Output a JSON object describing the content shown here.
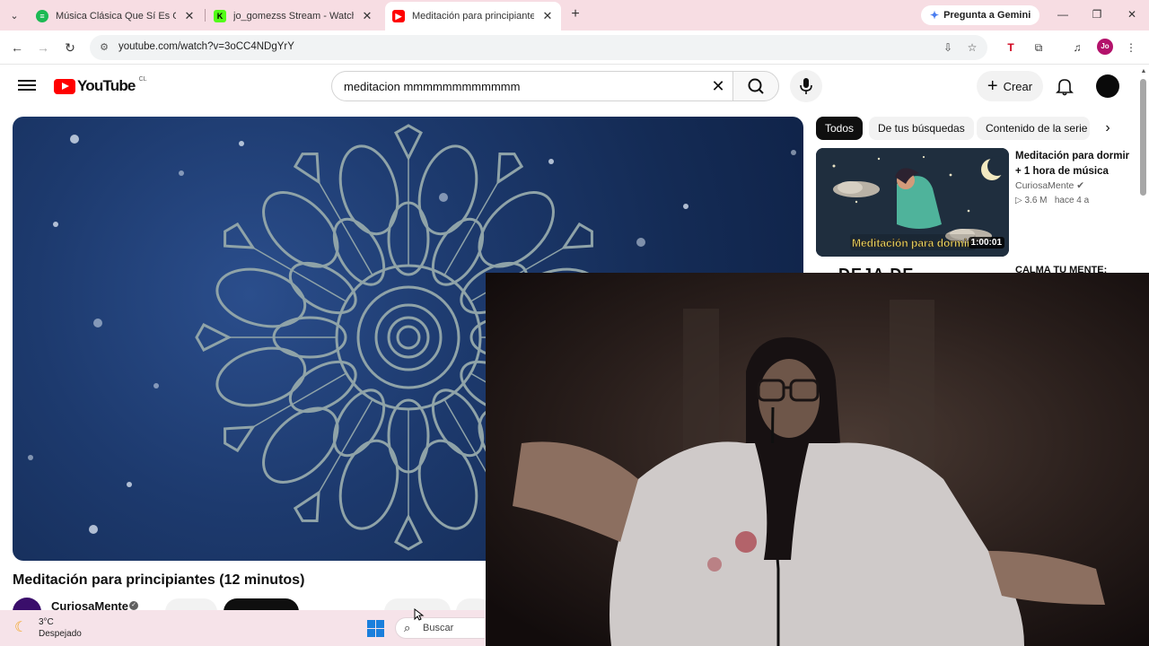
{
  "browser": {
    "tabs": [
      {
        "title": "Música Clásica Que Sí Es Clásica",
        "favicon": "spotify-icon",
        "color": "#1db954",
        "active": false
      },
      {
        "title": "jo_gomezss Stream - Watch Live",
        "favicon": "kick-icon",
        "color": "#53fc18",
        "active": false
      },
      {
        "title": "Meditación para principiantes (",
        "favicon": "youtube-icon",
        "color": "#ff0000",
        "active": true
      }
    ],
    "new_tab": "+",
    "gemini_button": "Pregunta a Gemini",
    "url": "youtube.com/watch?v=3oCC4NDgYrY",
    "profile_initials": "Jo"
  },
  "youtube": {
    "logo_text": "YouTube",
    "country_code": "CL",
    "search_query": "meditacion mmmmmmmmmmmm",
    "create_label": "Crear",
    "video": {
      "title": "Meditación para principiantes (12 minutos)",
      "channel": "CuriosaMente"
    },
    "chips": [
      "Todos",
      "De tus búsquedas",
      "Contenido de la serie"
    ],
    "recommendation": {
      "title": "Meditación para dormir + 1 hora de música",
      "channel": "CuriosaMente",
      "views": "3.6 M",
      "age": "hace 4 a",
      "duration": "1:00:01",
      "thumb_caption": "Meditación para dormir"
    },
    "next_fragment_left": "DEJA DE",
    "next_fragment_right": "CALMA TU MENTE:"
  },
  "taskbar": {
    "temperature": "3°C",
    "condition": "Despejado",
    "search_label": "Buscar"
  },
  "colors": {
    "tabstrip": "#f7dde3",
    "youtube_red": "#ff0000",
    "player_blue": "#1d3a6e",
    "mandala_stroke": "#8fa3a8"
  }
}
